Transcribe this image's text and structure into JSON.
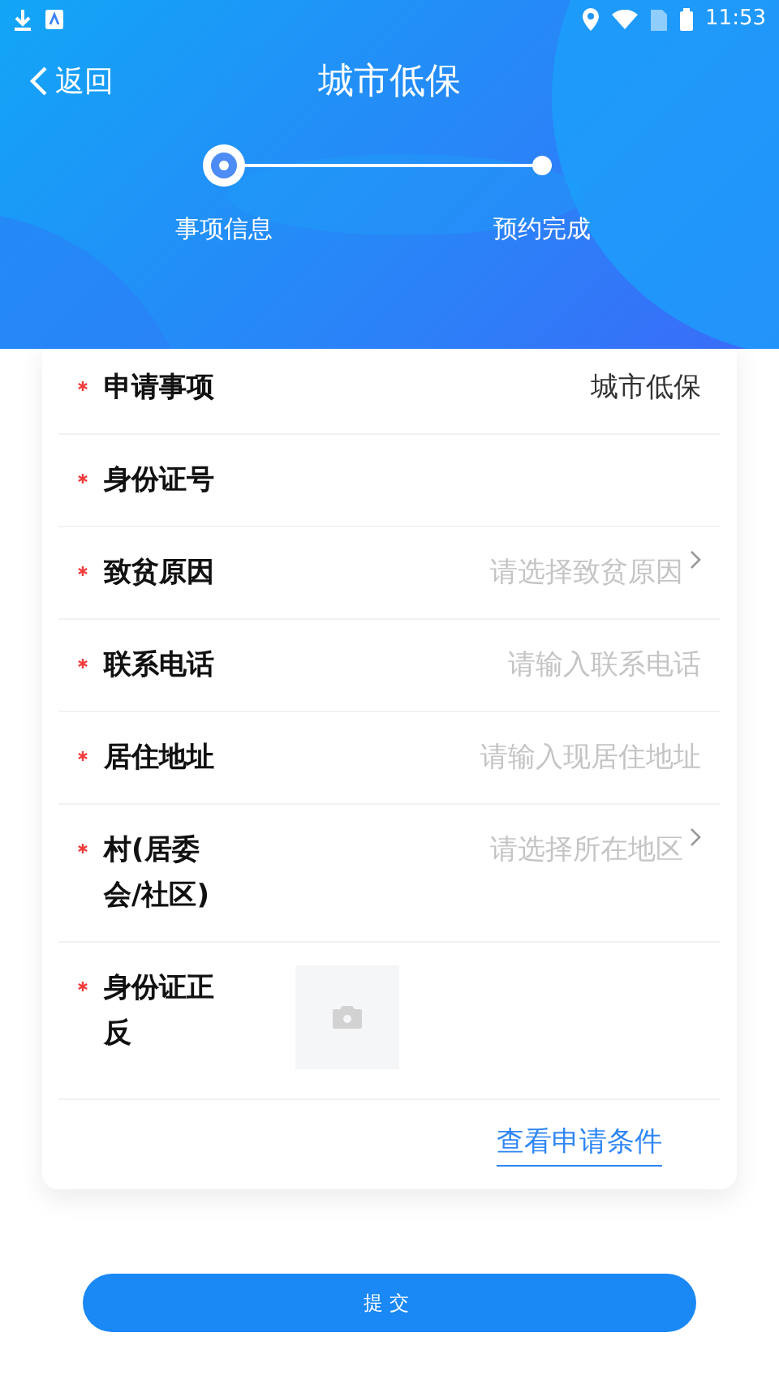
{
  "status_bar": {
    "time": "11:53"
  },
  "header": {
    "back": "返回",
    "title": "城市低保"
  },
  "steps": [
    {
      "label": "事项信息",
      "selected": true
    },
    {
      "label": "预约完成",
      "selected": false
    }
  ],
  "form": {
    "rows": [
      {
        "kind": "value",
        "label": "申请事项",
        "required": true,
        "value": "城市低保"
      },
      {
        "kind": "input",
        "label": "身份证号",
        "required": true
      },
      {
        "kind": "select",
        "label": "致贫原因",
        "required": true,
        "placeholder": "请选择致贫原因"
      },
      {
        "kind": "input",
        "label": "联系电话",
        "required": true,
        "placeholder": "请输入联系电话"
      },
      {
        "kind": "input",
        "label": "居住地址",
        "required": true,
        "placeholder": "请输入现居住地址"
      },
      {
        "kind": "select",
        "label": "村(居委会/社区)",
        "required": true,
        "placeholder": "请选择所在地区"
      },
      {
        "label": "身份证正反",
        "required": true
      }
    ],
    "link": "查看申请条件"
  },
  "submit": "提交"
}
